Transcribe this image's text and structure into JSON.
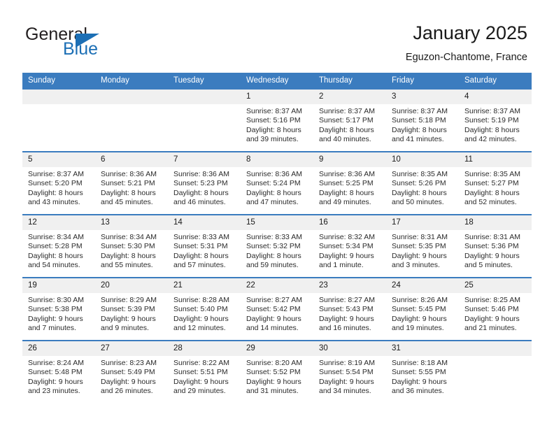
{
  "brand": {
    "word_top": "General",
    "word_bottom": "Blue",
    "triangle_icon": "triangle-icon",
    "accent_color": "#1c6fb5"
  },
  "header": {
    "title": "January 2025",
    "location": "Eguzon-Chantome, France"
  },
  "calendar": {
    "header_bg": "#3b7cbf",
    "daynum_bg": "#f0f0f0",
    "weekdays": [
      "Sunday",
      "Monday",
      "Tuesday",
      "Wednesday",
      "Thursday",
      "Friday",
      "Saturday"
    ],
    "weeks": [
      [
        {
          "day": "",
          "lines": []
        },
        {
          "day": "",
          "lines": []
        },
        {
          "day": "",
          "lines": []
        },
        {
          "day": "1",
          "lines": [
            "Sunrise: 8:37 AM",
            "Sunset: 5:16 PM",
            "Daylight: 8 hours",
            "and 39 minutes."
          ]
        },
        {
          "day": "2",
          "lines": [
            "Sunrise: 8:37 AM",
            "Sunset: 5:17 PM",
            "Daylight: 8 hours",
            "and 40 minutes."
          ]
        },
        {
          "day": "3",
          "lines": [
            "Sunrise: 8:37 AM",
            "Sunset: 5:18 PM",
            "Daylight: 8 hours",
            "and 41 minutes."
          ]
        },
        {
          "day": "4",
          "lines": [
            "Sunrise: 8:37 AM",
            "Sunset: 5:19 PM",
            "Daylight: 8 hours",
            "and 42 minutes."
          ]
        }
      ],
      [
        {
          "day": "5",
          "lines": [
            "Sunrise: 8:37 AM",
            "Sunset: 5:20 PM",
            "Daylight: 8 hours",
            "and 43 minutes."
          ]
        },
        {
          "day": "6",
          "lines": [
            "Sunrise: 8:36 AM",
            "Sunset: 5:21 PM",
            "Daylight: 8 hours",
            "and 45 minutes."
          ]
        },
        {
          "day": "7",
          "lines": [
            "Sunrise: 8:36 AM",
            "Sunset: 5:23 PM",
            "Daylight: 8 hours",
            "and 46 minutes."
          ]
        },
        {
          "day": "8",
          "lines": [
            "Sunrise: 8:36 AM",
            "Sunset: 5:24 PM",
            "Daylight: 8 hours",
            "and 47 minutes."
          ]
        },
        {
          "day": "9",
          "lines": [
            "Sunrise: 8:36 AM",
            "Sunset: 5:25 PM",
            "Daylight: 8 hours",
            "and 49 minutes."
          ]
        },
        {
          "day": "10",
          "lines": [
            "Sunrise: 8:35 AM",
            "Sunset: 5:26 PM",
            "Daylight: 8 hours",
            "and 50 minutes."
          ]
        },
        {
          "day": "11",
          "lines": [
            "Sunrise: 8:35 AM",
            "Sunset: 5:27 PM",
            "Daylight: 8 hours",
            "and 52 minutes."
          ]
        }
      ],
      [
        {
          "day": "12",
          "lines": [
            "Sunrise: 8:34 AM",
            "Sunset: 5:28 PM",
            "Daylight: 8 hours",
            "and 54 minutes."
          ]
        },
        {
          "day": "13",
          "lines": [
            "Sunrise: 8:34 AM",
            "Sunset: 5:30 PM",
            "Daylight: 8 hours",
            "and 55 minutes."
          ]
        },
        {
          "day": "14",
          "lines": [
            "Sunrise: 8:33 AM",
            "Sunset: 5:31 PM",
            "Daylight: 8 hours",
            "and 57 minutes."
          ]
        },
        {
          "day": "15",
          "lines": [
            "Sunrise: 8:33 AM",
            "Sunset: 5:32 PM",
            "Daylight: 8 hours",
            "and 59 minutes."
          ]
        },
        {
          "day": "16",
          "lines": [
            "Sunrise: 8:32 AM",
            "Sunset: 5:34 PM",
            "Daylight: 9 hours",
            "and 1 minute."
          ]
        },
        {
          "day": "17",
          "lines": [
            "Sunrise: 8:31 AM",
            "Sunset: 5:35 PM",
            "Daylight: 9 hours",
            "and 3 minutes."
          ]
        },
        {
          "day": "18",
          "lines": [
            "Sunrise: 8:31 AM",
            "Sunset: 5:36 PM",
            "Daylight: 9 hours",
            "and 5 minutes."
          ]
        }
      ],
      [
        {
          "day": "19",
          "lines": [
            "Sunrise: 8:30 AM",
            "Sunset: 5:38 PM",
            "Daylight: 9 hours",
            "and 7 minutes."
          ]
        },
        {
          "day": "20",
          "lines": [
            "Sunrise: 8:29 AM",
            "Sunset: 5:39 PM",
            "Daylight: 9 hours",
            "and 9 minutes."
          ]
        },
        {
          "day": "21",
          "lines": [
            "Sunrise: 8:28 AM",
            "Sunset: 5:40 PM",
            "Daylight: 9 hours",
            "and 12 minutes."
          ]
        },
        {
          "day": "22",
          "lines": [
            "Sunrise: 8:27 AM",
            "Sunset: 5:42 PM",
            "Daylight: 9 hours",
            "and 14 minutes."
          ]
        },
        {
          "day": "23",
          "lines": [
            "Sunrise: 8:27 AM",
            "Sunset: 5:43 PM",
            "Daylight: 9 hours",
            "and 16 minutes."
          ]
        },
        {
          "day": "24",
          "lines": [
            "Sunrise: 8:26 AM",
            "Sunset: 5:45 PM",
            "Daylight: 9 hours",
            "and 19 minutes."
          ]
        },
        {
          "day": "25",
          "lines": [
            "Sunrise: 8:25 AM",
            "Sunset: 5:46 PM",
            "Daylight: 9 hours",
            "and 21 minutes."
          ]
        }
      ],
      [
        {
          "day": "26",
          "lines": [
            "Sunrise: 8:24 AM",
            "Sunset: 5:48 PM",
            "Daylight: 9 hours",
            "and 23 minutes."
          ]
        },
        {
          "day": "27",
          "lines": [
            "Sunrise: 8:23 AM",
            "Sunset: 5:49 PM",
            "Daylight: 9 hours",
            "and 26 minutes."
          ]
        },
        {
          "day": "28",
          "lines": [
            "Sunrise: 8:22 AM",
            "Sunset: 5:51 PM",
            "Daylight: 9 hours",
            "and 29 minutes."
          ]
        },
        {
          "day": "29",
          "lines": [
            "Sunrise: 8:20 AM",
            "Sunset: 5:52 PM",
            "Daylight: 9 hours",
            "and 31 minutes."
          ]
        },
        {
          "day": "30",
          "lines": [
            "Sunrise: 8:19 AM",
            "Sunset: 5:54 PM",
            "Daylight: 9 hours",
            "and 34 minutes."
          ]
        },
        {
          "day": "31",
          "lines": [
            "Sunrise: 8:18 AM",
            "Sunset: 5:55 PM",
            "Daylight: 9 hours",
            "and 36 minutes."
          ]
        },
        {
          "day": "",
          "lines": []
        }
      ]
    ]
  }
}
